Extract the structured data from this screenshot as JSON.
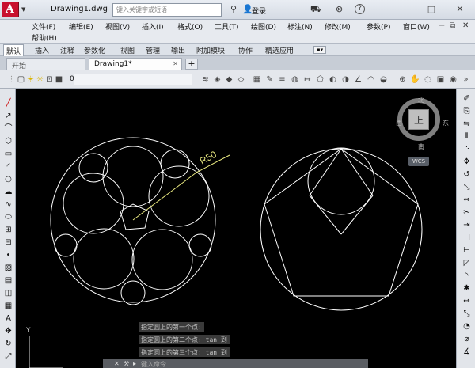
{
  "titlebar": {
    "doc_title": "Drawing1.dwg",
    "search_placeholder": "键入关键字或短语",
    "login_label": "登录",
    "win_min": "−",
    "win_max": "□",
    "win_close": "✕",
    "help_icon": "?"
  },
  "menubar": {
    "items": [
      "文件(F)",
      "编辑(E)",
      "视图(V)",
      "插入(I)",
      "格式(O)",
      "工具(T)",
      "绘图(D)",
      "标注(N)",
      "修改(M)",
      "参数(P)",
      "窗口(W)"
    ],
    "help": "帮助(H)"
  },
  "ribbon_tabs": [
    "默认",
    "插入",
    "注释",
    "参数化",
    "视图",
    "管理",
    "输出",
    "附加模块",
    "协作",
    "精选应用"
  ],
  "doc_tabs": {
    "start": "开始",
    "active": "Drawing1*",
    "close": "✕",
    "add": "+"
  },
  "toolbar": {
    "layer_value": "0"
  },
  "viewcube": {
    "north": "北",
    "south": "南",
    "west": "西",
    "east": "东",
    "top": "上",
    "wcs": "WCS"
  },
  "drawing": {
    "dimension_text": "R50"
  },
  "command": {
    "history": [
      "指定圆上的第一个点:",
      "指定圆上的第二个点: tan 到",
      "指定圆上的第三个点: tan 到"
    ],
    "close_btn": "✕",
    "wrench": "⚒",
    "prompt_icon": "▸",
    "placeholder": "键入命令"
  },
  "ucs": {
    "y_label": "Y"
  }
}
